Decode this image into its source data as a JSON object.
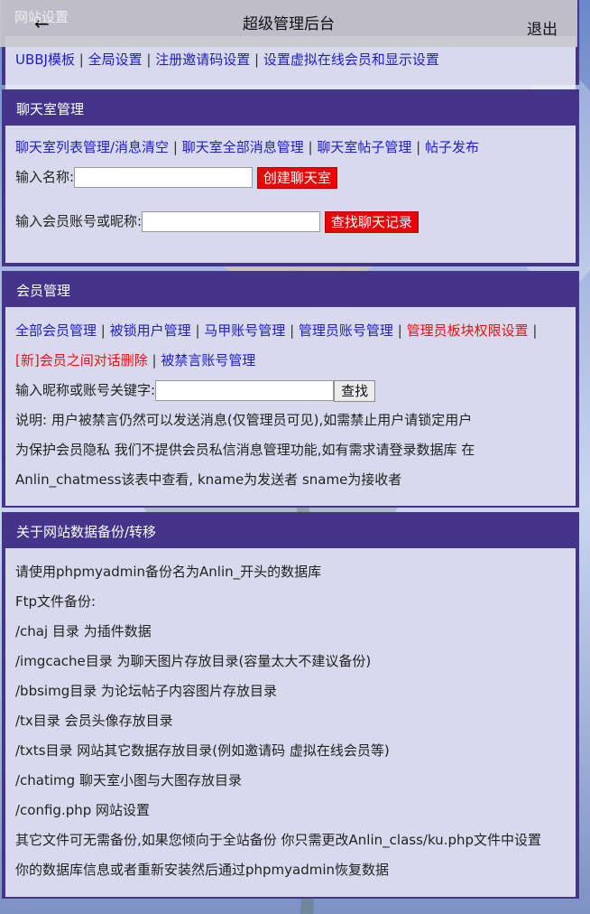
{
  "header": {
    "back_icon": "←",
    "title": "超级管理后台",
    "logout": "退出",
    "ghost_label": "网站设置"
  },
  "site_settings": {
    "links": [
      "UBBJ模板",
      "全局设置",
      "注册邀请码设置",
      "设置虚拟在线会员和显示设置"
    ]
  },
  "chat": {
    "title": "聊天室管理",
    "links": [
      "聊天室列表管理/消息清空",
      "聊天室全部消息管理",
      "聊天室帖子管理",
      "帖子发布"
    ],
    "name_label": "输入名称:",
    "create_btn": "创建聊天室",
    "account_label": "输入会员账号或昵称:",
    "find_btn": "查找聊天记录"
  },
  "members": {
    "title": "会员管理",
    "links_row1": [
      "全部会员管理",
      "被锁用户管理",
      "马甲账号管理",
      "管理员账号管理"
    ],
    "red_link_row1": "管理员板块权限设置",
    "red_link_row2": "[新]会员之间对话删除",
    "link_row2": "被禁言账号管理",
    "search_label": "输入昵称或账号关键字:",
    "search_btn": "查找",
    "note1": "说明: 用户被禁言仍然可以发送消息(仅管理员可见),如需禁止用户请锁定用户",
    "note2": "为保护会员隐私 我们不提供会员私信消息管理功能,如有需求请登录数据库 在",
    "note3": "Anlin_chatmess该表中查看, kname为发送者 sname为接收者"
  },
  "backup": {
    "title": "关于网站数据备份/转移",
    "lines": [
      "请使用phpmyadmin备份名为Anlin_开头的数据库",
      "Ftp文件备份:",
      "/chaj 目录 为插件数据",
      "/imgcache目录 为聊天图片存放目录(容量太大不建议备份)",
      "/bbsimg目录 为论坛帖子内容图片存放目录",
      "/tx目录 会员头像存放目录",
      "/txts目录 网站其它数据存放目录(例如邀请码 虚拟在线会员等)",
      "/chatimg 聊天室小图与大图存放目录",
      "/config.php 网站设置",
      "其它文件可无需备份,如果您倾向于全站备份 你只需更改Anlin_class/ku.php文件中设置",
      "你的数据库信息或者重新安装然后通过phpmyadmin恢复数据"
    ]
  }
}
